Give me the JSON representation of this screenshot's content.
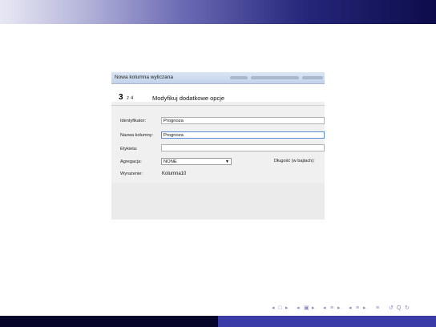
{
  "dialog": {
    "title": "Nowa kolumna wyliczana",
    "step_number": "3",
    "step_of": "z 4",
    "step_title": "Modyfikuj dodatkowe opcje"
  },
  "form": {
    "identifier_label": "Identyfikator:",
    "identifier_value": "Prognoza",
    "column_name_label": "Nazwa kolumny:",
    "column_name_value": "Prognoza",
    "label_label": "Etykieta:",
    "label_value": "",
    "aggregation_label": "Agregacja:",
    "aggregation_value": "NONE",
    "length_label": "Długość (w bajtach):",
    "expression_label": "Wyrażenie:",
    "expression_value": "Kolumna10"
  },
  "nav": {
    "symbols": [
      "◂",
      "□",
      "▸",
      "◂",
      "▣",
      "▸",
      "◂",
      "≡",
      "▸",
      "◂",
      "≡",
      "▸",
      "≡",
      "↺",
      "Q",
      "↻"
    ]
  },
  "colors": {
    "bar_dark": "#06062a",
    "bar_accent": "#3b3ba8",
    "nav_glyph": "#8a8ac8"
  }
}
